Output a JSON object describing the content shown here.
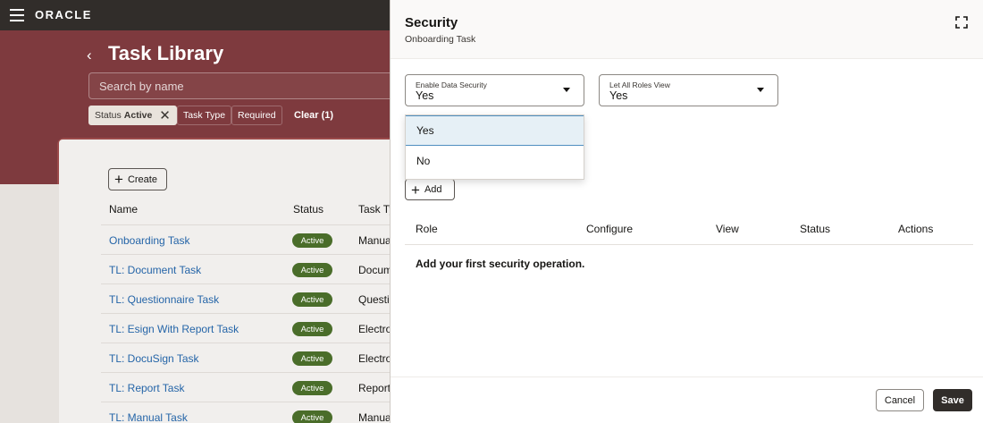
{
  "app": {
    "brand": "ORACLE"
  },
  "library": {
    "title": "Task Library",
    "search_placeholder": "Search by name",
    "filters": {
      "status_label": "Status",
      "status_value": "Active",
      "task_type": "Task Type",
      "required": "Required",
      "clear": "Clear (1)"
    },
    "create_label": "Create",
    "columns": {
      "name": "Name",
      "status": "Status",
      "task_type": "Task Ty"
    },
    "rows": [
      {
        "name": "Onboarding Task",
        "status": "Active",
        "type": "Manua"
      },
      {
        "name": "TL: Document Task",
        "status": "Active",
        "type": "Docum"
      },
      {
        "name": "TL: Questionnaire Task",
        "status": "Active",
        "type": "Questic"
      },
      {
        "name": "TL: Esign With Report Task",
        "status": "Active",
        "type": "Electro"
      },
      {
        "name": "TL: DocuSign Task",
        "status": "Active",
        "type": "Electro"
      },
      {
        "name": "TL: Report Task",
        "status": "Active",
        "type": "Report"
      },
      {
        "name": "TL: Manual Task",
        "status": "Active",
        "type": "Manua"
      }
    ]
  },
  "drawer": {
    "title": "Security",
    "subtitle": "Onboarding Task",
    "enable_data_security": {
      "label": "Enable Data Security",
      "value": "Yes"
    },
    "let_all_roles_view": {
      "label": "Let All Roles View",
      "value": "Yes"
    },
    "dropdown_options": [
      "Yes",
      "No"
    ],
    "add_label": "Add",
    "columns": {
      "role": "Role",
      "configure": "Configure",
      "view": "View",
      "status": "Status",
      "actions": "Actions"
    },
    "empty_message": "Add your first security operation.",
    "cancel_label": "Cancel",
    "save_label": "Save"
  },
  "colors": {
    "topbar": "#312d2a",
    "hero": "#7e3a3e",
    "link": "#2565a8",
    "active_badge": "#4a6d2a",
    "primary_button": "#312d2a",
    "selected_option": "#e6f0f6"
  }
}
